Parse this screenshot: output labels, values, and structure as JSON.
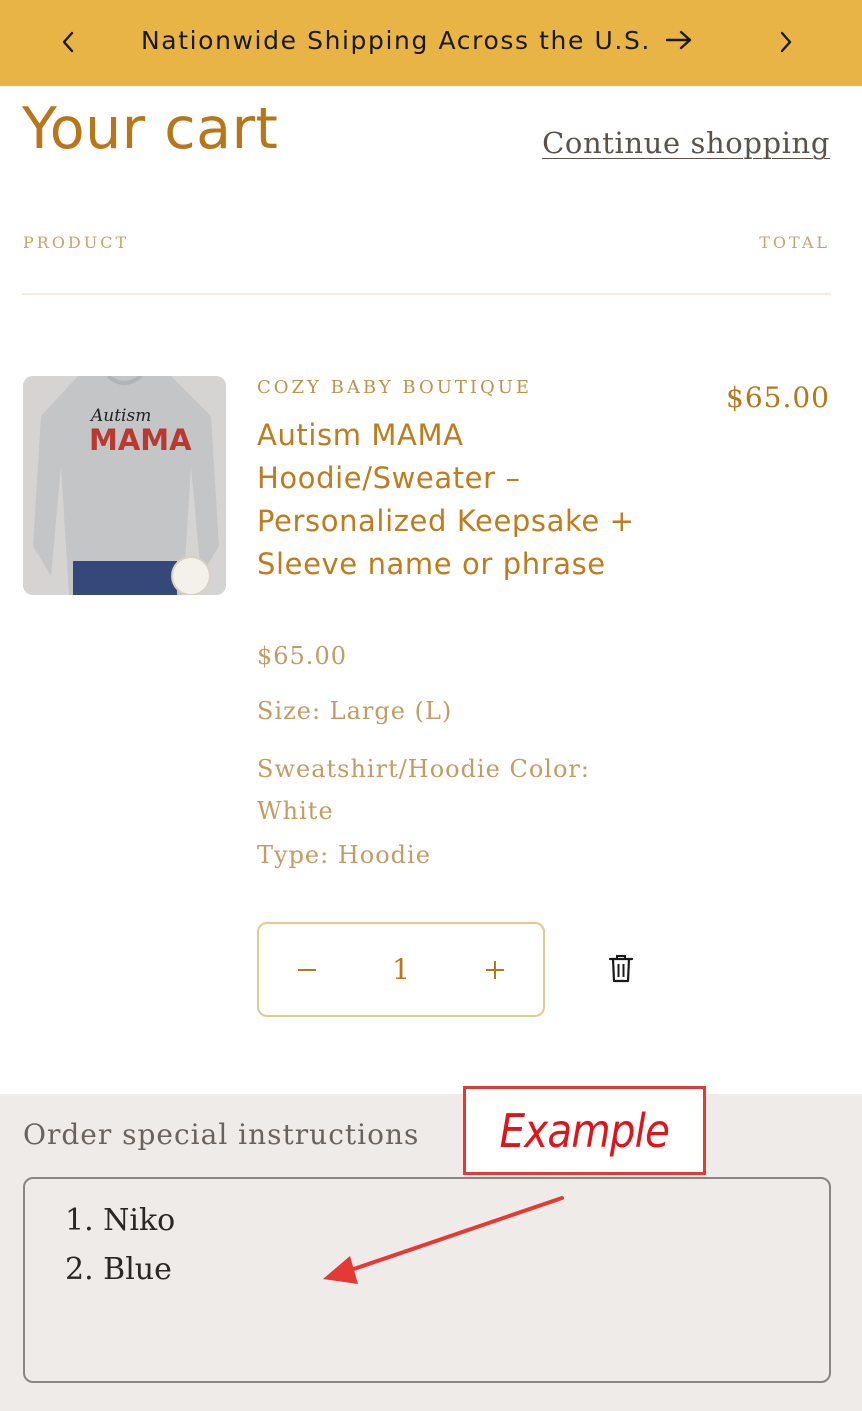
{
  "announcement": {
    "message": "Nationwide Shipping Across the U.S.",
    "bg_color": "#e8b445",
    "prev_icon": "chevron-left-icon",
    "next_icon": "chevron-right-icon",
    "arrow_icon": "arrow-right-icon"
  },
  "header": {
    "title": "Your cart",
    "continue_label": "Continue shopping",
    "accent_color": "#b8761a"
  },
  "table": {
    "col_product": "PRODUCT",
    "col_total": "TOTAL"
  },
  "item": {
    "vendor": "COZY BABY BOUTIQUE",
    "name": "Autism MAMA Hoodie/Sweater – Personalized Keepsake + Sleeve name or phrase",
    "unit_price": "$65.00",
    "line_total": "$65.00",
    "size": "Size: Large (L)",
    "color": "Sweatshirt/Hoodie Color: White",
    "type": "Type: Hoodie",
    "quantity": "1",
    "image_text_script": "Autism",
    "image_text_bold": "MAMA",
    "decrease_icon": "minus-icon",
    "increase_icon": "plus-icon",
    "remove_icon": "trash-icon"
  },
  "notes": {
    "label": "Order special instructions",
    "lines": [
      "1. Niko",
      "2. Blue"
    ]
  },
  "annotation": {
    "label": "Example",
    "color": "#e53935"
  }
}
